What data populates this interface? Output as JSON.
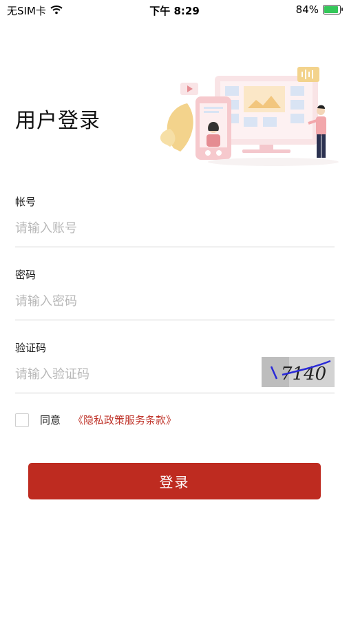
{
  "status_bar": {
    "carrier": "无SIM卡",
    "time": "下午 8:29",
    "battery_percent": "84%",
    "battery_level": 0.84,
    "icons": [
      "wifi-icon",
      "battery-charging-icon"
    ]
  },
  "header": {
    "title": "用户登录"
  },
  "form": {
    "account": {
      "label": "帐号",
      "placeholder": "请输入账号",
      "value": ""
    },
    "password": {
      "label": "密码",
      "placeholder": "请输入密码",
      "value": ""
    },
    "captcha": {
      "label": "验证码",
      "placeholder": "请输入验证码",
      "value": "",
      "image_text": "7140"
    }
  },
  "agreement": {
    "checked": false,
    "text": "同意",
    "link_text": "《隐私政策服务条款》"
  },
  "login_button": {
    "label": "登录"
  },
  "colors": {
    "primary": "#be2b20",
    "link": "#c0362c",
    "placeholder": "#b8b8b8",
    "divider": "#cfcfcf"
  }
}
